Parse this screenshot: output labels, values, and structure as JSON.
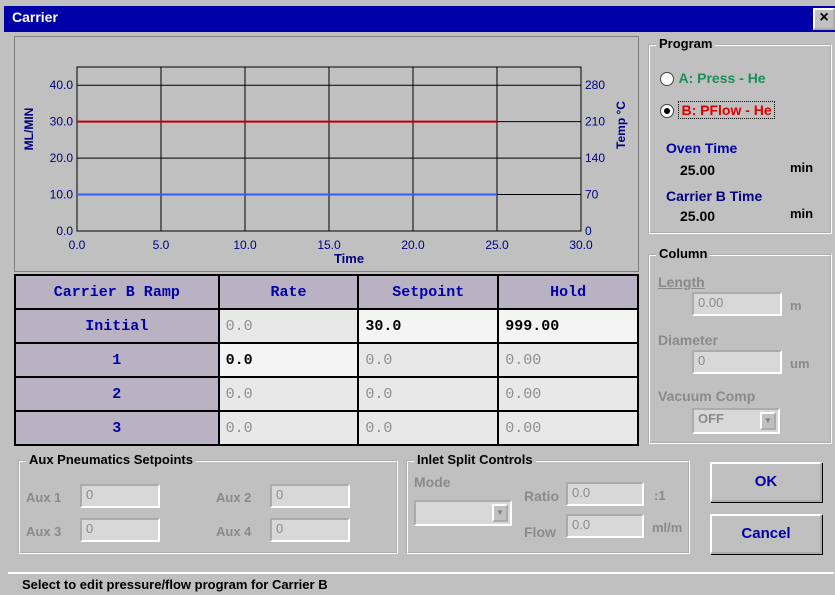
{
  "window": {
    "title": "Carrier",
    "close": "×"
  },
  "chart_data": {
    "type": "line",
    "xlabel": "Time",
    "ylabel": "ML/MIN",
    "y2label": "Temp °C",
    "xlim": [
      0,
      30
    ],
    "ylim": [
      0,
      45
    ],
    "y2lim": [
      0,
      315
    ],
    "xticks": [
      "0.0",
      "5.0",
      "10.0",
      "15.0",
      "20.0",
      "25.0",
      "30.0"
    ],
    "yticks": [
      "0.0",
      "10.0",
      "20.0",
      "30.0",
      "40.0"
    ],
    "y2ticks": [
      "0",
      "70",
      "140",
      "210",
      "280"
    ],
    "series": [
      {
        "color": "#c00000",
        "x": [
          0,
          25
        ],
        "y": [
          30,
          30
        ]
      },
      {
        "color": "#3060ff",
        "x": [
          0,
          25
        ],
        "y": [
          10,
          10
        ]
      }
    ],
    "grid": true
  },
  "ramp_table": {
    "headers": [
      "Carrier B Ramp",
      "Rate",
      "Setpoint",
      "Hold"
    ],
    "rows": [
      {
        "label": "Initial",
        "rate": "0.0",
        "setpoint": "30.0",
        "hold": "999.00"
      },
      {
        "label": "1",
        "rate": "0.0",
        "setpoint": "0.0",
        "hold": "0.00"
      },
      {
        "label": "2",
        "rate": "0.0",
        "setpoint": "0.0",
        "hold": "0.00"
      },
      {
        "label": "3",
        "rate": "0.0",
        "setpoint": "0.0",
        "hold": "0.00"
      }
    ]
  },
  "program": {
    "title": "Program",
    "option_a": "A: Press - He",
    "option_b": "B: PFlow - He",
    "oven_time_label": "Oven Time",
    "oven_time_value": "25.00",
    "oven_time_unit": "min",
    "carrier_time_label": "Carrier B Time",
    "carrier_time_value": "25.00",
    "carrier_time_unit": "min"
  },
  "column": {
    "title": "Column",
    "length_label": "Length",
    "length_value": "0.00",
    "length_unit": "m",
    "diameter_label": "Diameter",
    "diameter_value": "0",
    "diameter_unit": "um",
    "vacuum_label": "Vacuum Comp",
    "vacuum_value": "OFF"
  },
  "aux": {
    "title": "Aux Pneumatics Setpoints",
    "aux1_label": "Aux 1",
    "aux1_value": "0",
    "aux2_label": "Aux 2",
    "aux2_value": "0",
    "aux3_label": "Aux 3",
    "aux3_value": "0",
    "aux4_label": "Aux 4",
    "aux4_value": "0"
  },
  "inlet": {
    "title": "Inlet Split Controls",
    "mode_label": "Mode",
    "ratio_label": "Ratio",
    "ratio_value": "0.0",
    "ratio_unit": ":1",
    "flow_label": "Flow",
    "flow_value": "0.0",
    "flow_unit": "ml/m"
  },
  "buttons": {
    "ok": "OK",
    "cancel": "Cancel"
  },
  "status": "Select to edit pressure/flow program for Carrier B"
}
